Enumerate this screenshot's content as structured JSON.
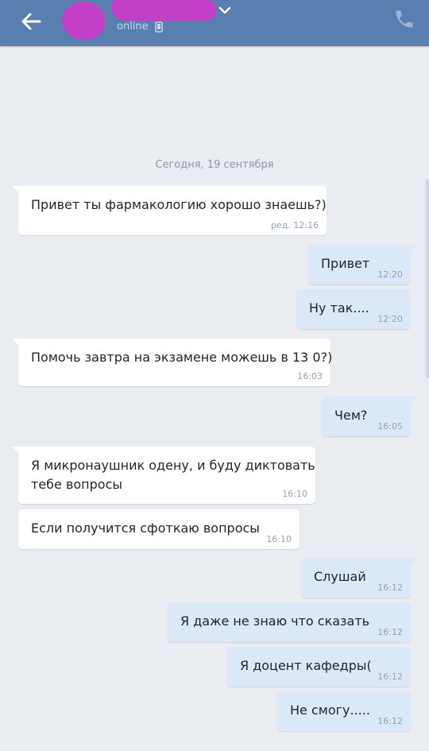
{
  "header": {
    "status": "online"
  },
  "chat": {
    "date_separator": "Сегодня, 19 сентября",
    "messages": [
      {
        "dir": "in",
        "text": "Привет ты фармакологию хорошо знаешь?)",
        "time": "ред. 12:16"
      },
      {
        "dir": "out",
        "text": "Привет",
        "time": "12:20"
      },
      {
        "dir": "out",
        "text": "Ну так....",
        "time": "12:20"
      },
      {
        "dir": "in",
        "text": "Помочь завтра на экзамене можешь в 13 0?)",
        "time": "16:03"
      },
      {
        "dir": "out",
        "text": "Чем?",
        "time": "16:05"
      },
      {
        "dir": "in",
        "text": "Я микронаушник одену, и буду диктовать\nтебе вопросы",
        "time": "16:10"
      },
      {
        "dir": "in",
        "text": "Если получится сфоткаю вопросы",
        "time": "16:10"
      },
      {
        "dir": "out",
        "text": "Слушай",
        "time": "16:12"
      },
      {
        "dir": "out",
        "text": "Я даже не знаю что сказать",
        "time": "16:12"
      },
      {
        "dir": "out",
        "text": "Я доцент кафедры(",
        "time": "16:12"
      },
      {
        "dir": "out",
        "text": "Не смогу.....",
        "time": "16:12"
      }
    ]
  },
  "colors": {
    "header": "#587fb0",
    "background": "#e9ecf0",
    "incoming": "#ffffff",
    "outgoing": "#dbe8f8",
    "redaction": "#c43fc8"
  },
  "icons": {
    "back": "arrow-left-icon",
    "dropdown": "chevron-down-icon",
    "device": "mobile-device-icon",
    "call": "phone-icon"
  }
}
